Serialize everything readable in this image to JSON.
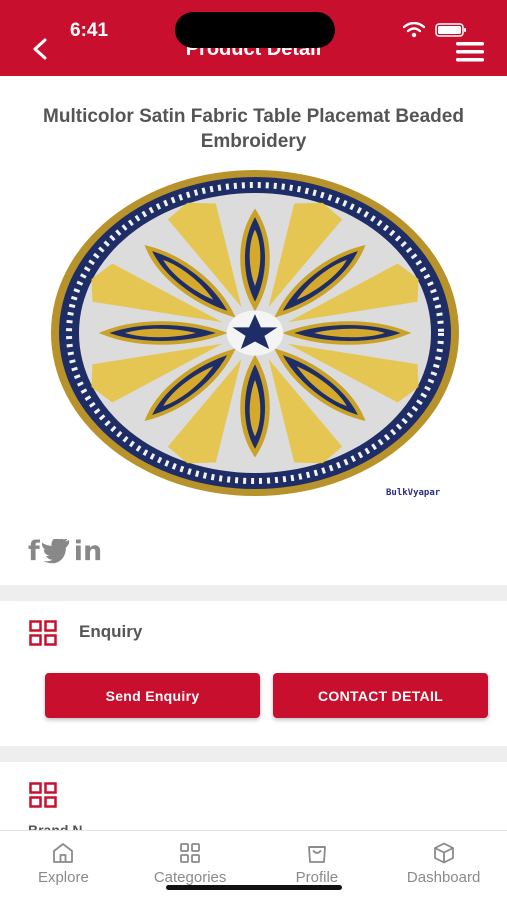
{
  "status": {
    "time": "6:41"
  },
  "header": {
    "title": "Product Detail"
  },
  "product": {
    "title": "Multicolor Satin Fabric Table Placemat Beaded Embroidery",
    "watermark": "BulkVyapar"
  },
  "social": {
    "icons": [
      "facebook-icon",
      "twitter-icon",
      "linkedin-icon"
    ]
  },
  "enquiry": {
    "label": "Enquiry",
    "send_button": "Send Enquiry",
    "contact_button": "CONTACT DETAIL"
  },
  "next_section": {
    "partial_label": "Brand N"
  },
  "bottom_nav": {
    "items": [
      {
        "label": "Explore"
      },
      {
        "label": "Categories"
      },
      {
        "label": "Profile"
      },
      {
        "label": "Dashboard"
      }
    ]
  },
  "colors": {
    "brand": "#c8102e",
    "text_gray": "#555555",
    "nav_gray": "#8a8a8a"
  }
}
